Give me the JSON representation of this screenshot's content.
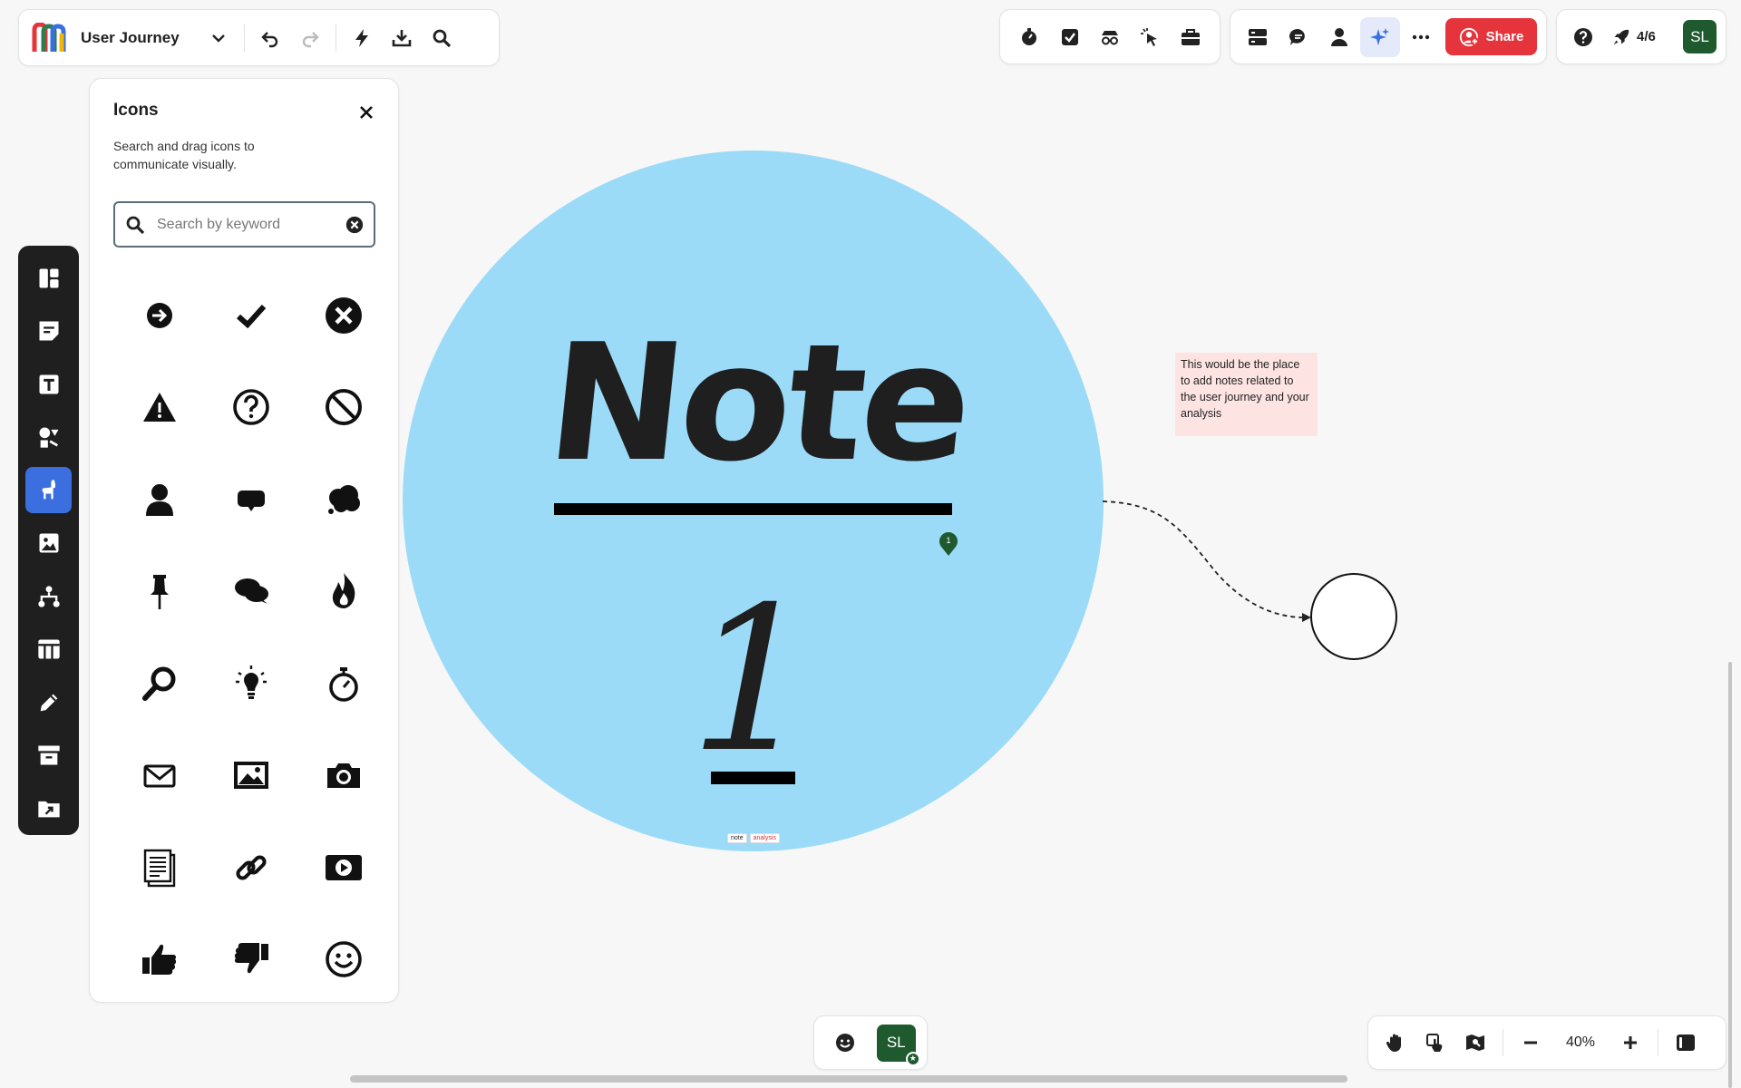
{
  "app": {
    "board_title": "User Journey",
    "share_label": "Share",
    "progress": "4/6",
    "user_initials": "SL",
    "accent_color": "#3b6fe0",
    "share_color": "#e5343b",
    "avatar_color": "#1e5a2e"
  },
  "icons_panel": {
    "title": "Icons",
    "description": "Search and drag icons to communicate visually.",
    "search_placeholder": "Search by keyword",
    "icons": [
      "arrow-right-icon",
      "check-icon",
      "x-circle-icon",
      "warning-icon",
      "question-icon",
      "prohibited-icon",
      "user-icon",
      "speech-bubble-icon",
      "thought-bubble-icon",
      "pin-icon",
      "chat-icon",
      "fire-icon",
      "magnifier-icon",
      "lightbulb-icon",
      "stopwatch-icon",
      "envelope-icon",
      "image-icon",
      "camera-icon",
      "document-icon",
      "link-icon",
      "video-icon",
      "thumbs-up-icon",
      "thumbs-down-icon",
      "smiley-icon"
    ]
  },
  "canvas": {
    "note_title": "Note",
    "note_number": "1",
    "pin_label": "1",
    "tags": [
      "note",
      "analysis"
    ],
    "sticky_note": "This would be the place to add notes related to the user journey and your analysis",
    "circle_color": "#9cdbf8",
    "sticky_color": "#fde4e3"
  },
  "zoom": {
    "level": "40%"
  }
}
